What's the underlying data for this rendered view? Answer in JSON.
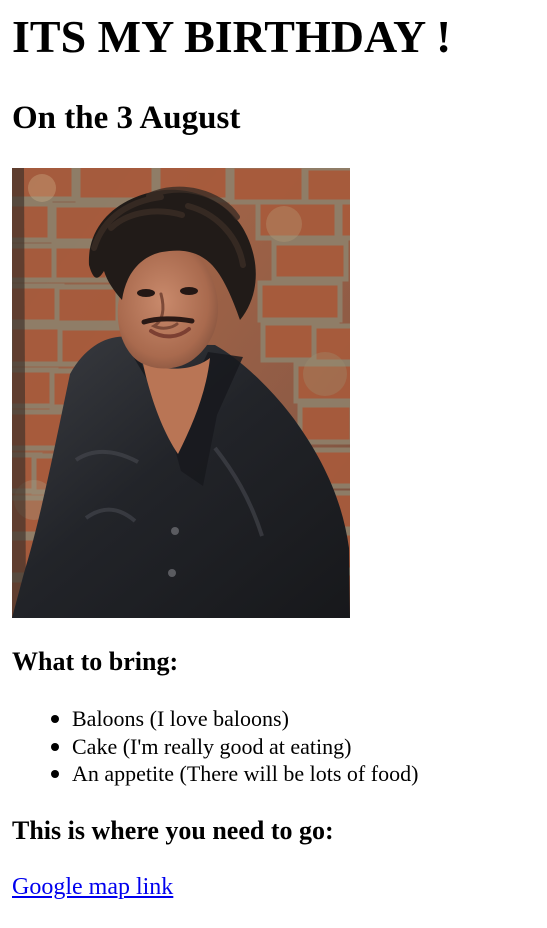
{
  "page": {
    "title": "ITS MY BIRTHDAY !",
    "subtitle": "On the 3 August"
  },
  "photo": {
    "subject": "portrait-photo",
    "colors": {
      "brick": "#a85b3c",
      "mortar": "#8d7f67",
      "shirt": "#25282d",
      "skin": "#b77a5d",
      "hair": "#211b18"
    }
  },
  "bring": {
    "heading": "What to bring:",
    "items": [
      "Baloons (I love baloons)",
      "Cake (I'm really good at eating)",
      "An appetite (There will be lots of food)"
    ]
  },
  "directions": {
    "heading": "This is where you need to go:",
    "link_label": "Google map link",
    "link_color": "#0000ee"
  }
}
